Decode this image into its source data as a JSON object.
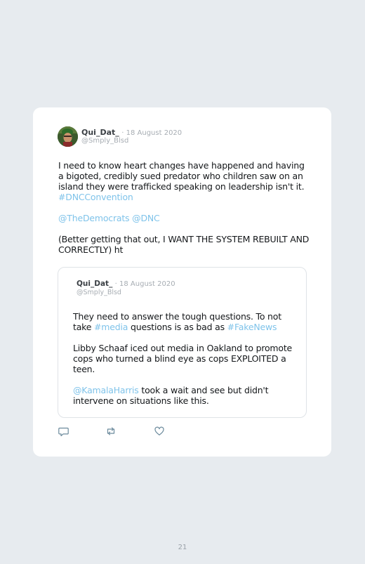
{
  "tweet": {
    "display_name": "Qui_Dat_",
    "date": "· 18 August 2020",
    "handle": "@Smply_Blsd",
    "paragraph1": "I need to know heart changes have happened and having a bigoted, credibly sued predator who children saw on an island they were trafficked speaking on leadership isn't it.",
    "hashtag1": "#DNCConvention",
    "mention1": "@TheDemocrats",
    "mention2": "@DNC",
    "paragraph3": "(Better getting that out, I WANT THE SYSTEM REBUILT AND CORRECTLY) ht"
  },
  "quoted": {
    "display_name": "Qui_Dat_",
    "date": "· 18 August 2020",
    "handle": "@Smply_Blsd",
    "p1_a": "They need to answer the tough questions. To not take ",
    "p1_tag1": "#media",
    "p1_b": " questions is as bad as ",
    "p1_tag2": "#FakeNews",
    "p2": "Libby Schaaf iced out media in Oakland to promote cops who turned a blind eye as cops EXPLOITED a teen.",
    "p3_mention": "@KamalaHarris",
    "p3_rest": " took a wait and see but didn't intervene on situations like this."
  },
  "actions": {
    "reply_icon": "reply-icon",
    "retweet_icon": "retweet-icon",
    "like_icon": "heart-icon"
  },
  "page_number": "21",
  "colors": {
    "link": "#7fc3ea",
    "background": "#e7ebef",
    "card": "#ffffff"
  }
}
